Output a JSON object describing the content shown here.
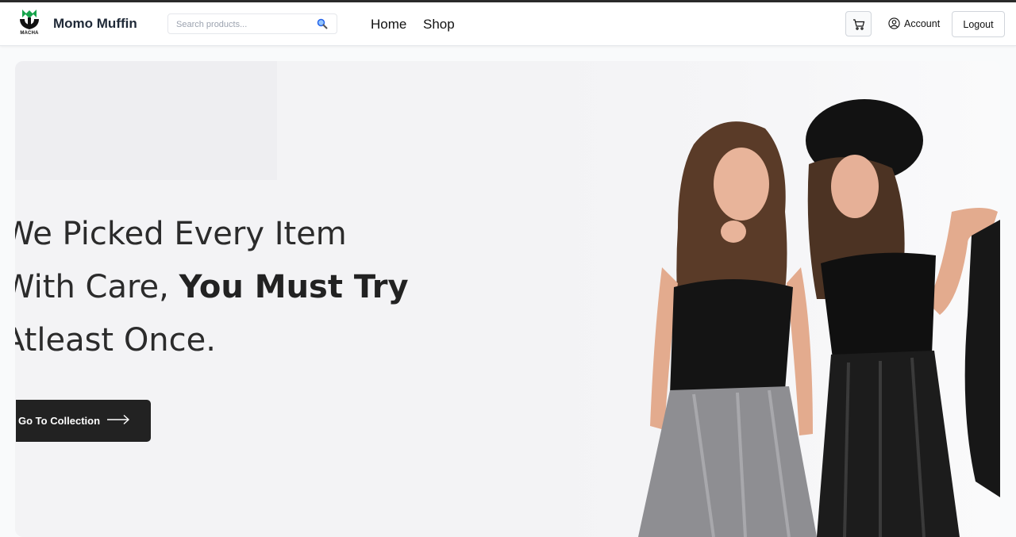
{
  "navbar": {
    "logo_text": "MACHA",
    "brand": "Momo Muffin",
    "search": {
      "placeholder": "Search products...",
      "value": ""
    },
    "links": [
      {
        "label": "Home"
      },
      {
        "label": "Shop"
      }
    ],
    "account_label": "Account",
    "logout_label": "Logout"
  },
  "hero": {
    "headline_line1": "We Picked Every Item",
    "headline_line2_regular": "With Care, ",
    "headline_line2_bold": "You Must Try",
    "headline_line3": "Atleast Once.",
    "cta_label": "Go To Collection"
  },
  "colors": {
    "accent_dark": "#222222",
    "logo_green": "#16a34a",
    "search_icon": "#3b82f6"
  },
  "icons": [
    "logo-icon",
    "search-icon",
    "cart-icon",
    "account-icon",
    "arrow-right-icon"
  ]
}
